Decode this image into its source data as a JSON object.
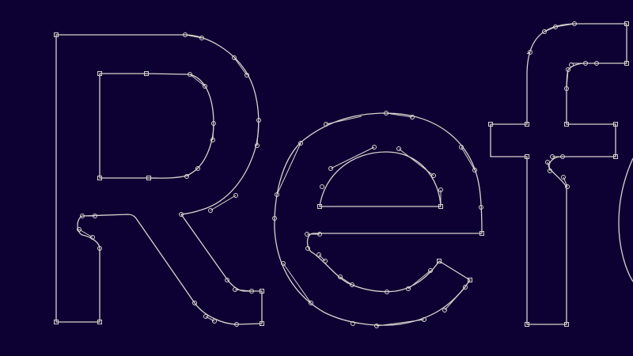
{
  "canvas": {
    "background": "#0d0033",
    "outline_color": "#d8d4cc"
  },
  "word": {
    "visible_letters": [
      "R",
      "e",
      "f",
      "o"
    ],
    "note_text": ""
  }
}
